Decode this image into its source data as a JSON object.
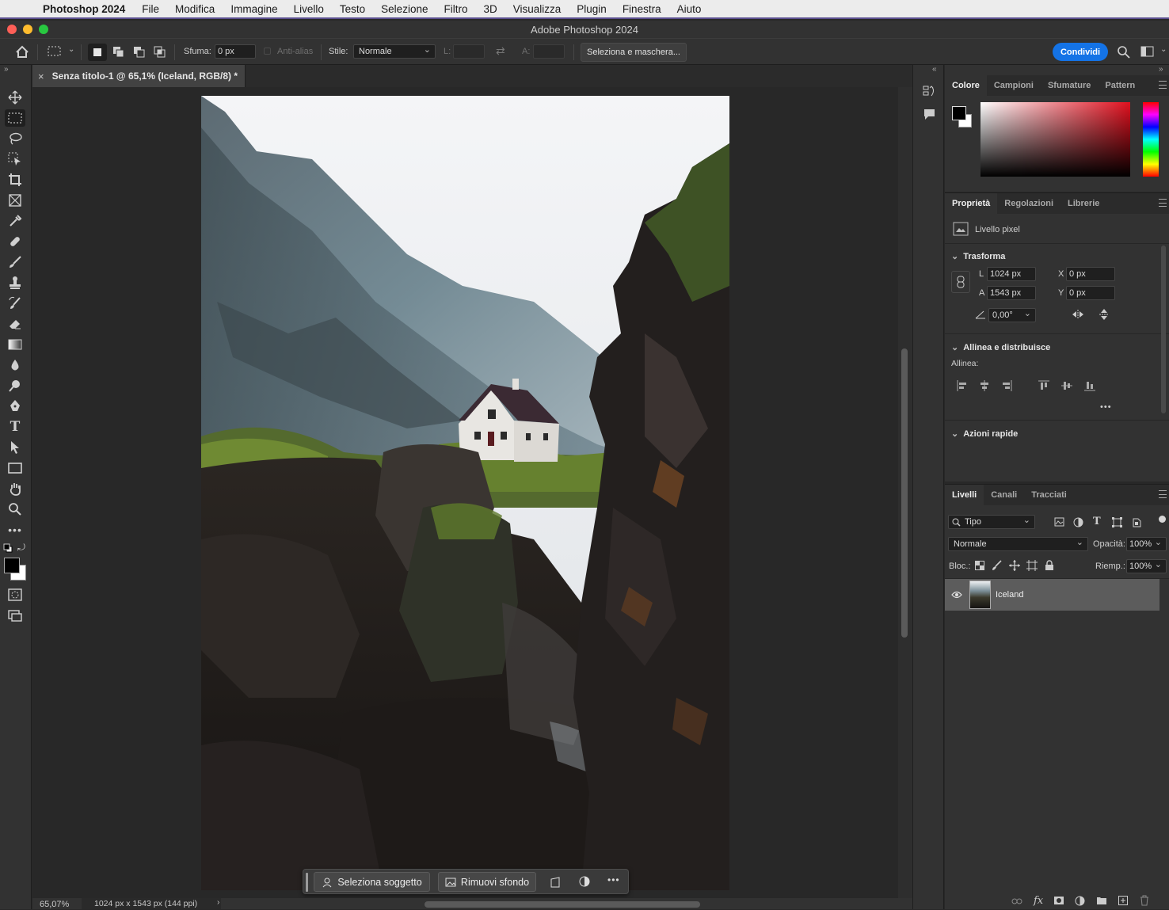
{
  "menubar": {
    "app_name": "Photoshop 2024",
    "items": [
      "File",
      "Modifica",
      "Immagine",
      "Livello",
      "Testo",
      "Selezione",
      "Filtro",
      "3D",
      "Visualizza",
      "Plugin",
      "Finestra",
      "Aiuto"
    ]
  },
  "window": {
    "title": "Adobe Photoshop 2024"
  },
  "options_bar": {
    "feather_label": "Sfuma:",
    "feather_value": "0 px",
    "antialias_label": "Anti-alias",
    "style_label": "Stile:",
    "style_value": "Normale",
    "width_label": "L:",
    "height_label": "A:",
    "select_mask_label": "Seleziona e maschera...",
    "share_label": "Condividi"
  },
  "document": {
    "tab_title": "Senza titolo-1 @ 65,1% (Iceland, RGB/8) *"
  },
  "status": {
    "zoom": "65,07%",
    "doc_info": "1024 px x 1543 px (144 ppi)"
  },
  "taskbar": {
    "select_subject": "Seleziona soggetto",
    "remove_bg": "Rimuovi sfondo"
  },
  "color_panel": {
    "tabs": [
      "Colore",
      "Campioni",
      "Sfumature",
      "Pattern"
    ]
  },
  "properties_panel": {
    "tabs": [
      "Proprietà",
      "Regolazioni",
      "Librerie"
    ],
    "layer_type": "Livello pixel",
    "transform_title": "Trasforma",
    "w_label": "L",
    "w_value": "1024 px",
    "h_label": "A",
    "h_value": "1543 px",
    "x_label": "X",
    "x_value": "0 px",
    "y_label": "Y",
    "y_value": "0 px",
    "angle_value": "0,00°",
    "align_title": "Allinea e distribuisce",
    "align_label": "Allinea:",
    "quick_actions_title": "Azioni rapide"
  },
  "layers_panel": {
    "tabs": [
      "Livelli",
      "Canali",
      "Tracciati"
    ],
    "filter_value": "Tipo",
    "blend_mode": "Normale",
    "opacity_label": "Opacità:",
    "opacity_value": "100%",
    "lock_label": "Bloc.:",
    "fill_label": "Riemp.:",
    "fill_value": "100%",
    "layers": [
      {
        "name": "Iceland",
        "visible": true
      }
    ]
  },
  "colors": {
    "accent_blue": "#1473e6",
    "foreground": "#000000",
    "background": "#ffffff"
  }
}
